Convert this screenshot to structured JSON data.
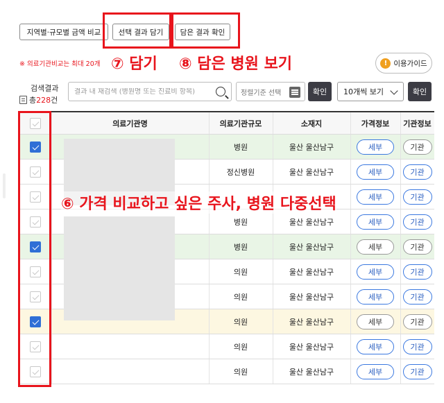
{
  "toolbar": {
    "region_compare": "지역별·규모별 금액 비교",
    "add_selected": "선택 결과 담기",
    "view_added": "담은 결과 확인"
  },
  "note": "※ 의료기관비교는 최대 20개",
  "annotations": {
    "step7": "⑦ 담기",
    "step8": "⑧ 담은 병원 보기",
    "step6": "⑥ 가격 비교하고 싶은 주사, 병원 다중선택"
  },
  "guide_button": {
    "icon": "!",
    "label": "이용가이드"
  },
  "search_result": {
    "label": "검색결과",
    "total_prefix": "총",
    "count": "228",
    "unit": "건"
  },
  "search": {
    "placeholder": "결과 내 재검색 (병원명 또는 진료비 항목)"
  },
  "sort": {
    "placeholder": "정렬기준 선택"
  },
  "confirm_label": "확인",
  "per_page": {
    "selected": "10개씩 보기"
  },
  "columns": [
    "의료기관명",
    "의료기관규모",
    "소재지",
    "가격정보",
    "기관정보"
  ],
  "detail_label": "세부",
  "org_label": "기관",
  "rows": [
    {
      "checked": true,
      "highlight": "green",
      "size": "병원",
      "location": "울산 울산남구",
      "detail_style": "blue",
      "org_style": "grey"
    },
    {
      "checked": false,
      "highlight": "none",
      "size": "정신병원",
      "location": "울산 울산남구",
      "detail_style": "blue",
      "org_style": "blue"
    },
    {
      "checked": false,
      "highlight": "none",
      "size": "",
      "location": "",
      "detail_style": "blue",
      "org_style": "blue"
    },
    {
      "checked": false,
      "highlight": "none",
      "size": "병원",
      "location": "울산 울산남구",
      "detail_style": "blue",
      "org_style": "blue"
    },
    {
      "checked": true,
      "highlight": "green",
      "size": "병원",
      "location": "울산 울산남구",
      "detail_style": "grey",
      "org_style": "grey"
    },
    {
      "checked": false,
      "highlight": "none",
      "size": "의원",
      "location": "울산 울산남구",
      "detail_style": "blue",
      "org_style": "blue"
    },
    {
      "checked": false,
      "highlight": "none",
      "size": "의원",
      "location": "울산 울산남구",
      "detail_style": "blue",
      "org_style": "blue"
    },
    {
      "checked": true,
      "highlight": "yellow",
      "size": "의원",
      "location": "울산 울산남구",
      "detail_style": "grey",
      "org_style": "grey"
    },
    {
      "checked": false,
      "highlight": "none",
      "size": "의원",
      "location": "울산 울산남구",
      "detail_style": "blue",
      "org_style": "blue"
    },
    {
      "checked": false,
      "highlight": "none",
      "size": "의원",
      "location": "울산 울산남구",
      "detail_style": "blue",
      "org_style": "blue"
    }
  ],
  "colors": {
    "annotation_red": "#e8141c",
    "row_green": "#e9f5e6",
    "row_yellow": "#fdf7e1",
    "checkbox_blue": "#2f6fd6",
    "pill_blue": "#3a78e0"
  }
}
